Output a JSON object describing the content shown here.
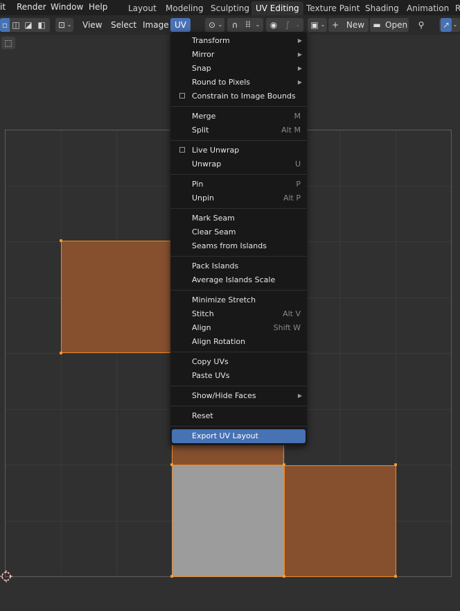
{
  "topbar": {
    "menus": [
      "it",
      "Render",
      "Window",
      "Help"
    ],
    "workspaces": [
      "Layout",
      "Modeling",
      "Sculpting",
      "UV Editing",
      "Texture Paint",
      "Shading",
      "Animation",
      "R"
    ],
    "active_workspace": "UV Editing"
  },
  "header": {
    "view": "View",
    "select": "Select",
    "image": "Image",
    "uv": "UV",
    "new": "New",
    "open": "Open"
  },
  "uv_menu": {
    "items": [
      {
        "label": "Transform",
        "submenu": true
      },
      {
        "label": "Mirror",
        "submenu": true
      },
      {
        "label": "Snap",
        "submenu": true
      },
      {
        "label": "Round to Pixels",
        "submenu": true
      },
      {
        "label": "Constrain to Image Bounds",
        "checkbox": true
      },
      {
        "label": "Merge",
        "shortcut": "M"
      },
      {
        "label": "Split",
        "shortcut": "Alt M"
      },
      {
        "label": "Live Unwrap",
        "checkbox": true
      },
      {
        "label": "Unwrap",
        "shortcut": "U"
      },
      {
        "label": "Pin",
        "shortcut": "P"
      },
      {
        "label": "Unpin",
        "shortcut": "Alt P"
      },
      {
        "label": "Mark Seam"
      },
      {
        "label": "Clear Seam"
      },
      {
        "label": "Seams from Islands"
      },
      {
        "label": "Pack Islands"
      },
      {
        "label": "Average Islands Scale"
      },
      {
        "label": "Minimize Stretch"
      },
      {
        "label": "Stitch",
        "shortcut": "Alt V"
      },
      {
        "label": "Align",
        "shortcut": "Shift W"
      },
      {
        "label": "Align Rotation"
      },
      {
        "label": "Copy UVs"
      },
      {
        "label": "Paste UVs"
      },
      {
        "label": "Show/Hide Faces",
        "submenu": true
      },
      {
        "label": "Reset"
      },
      {
        "label": "Export UV Layout",
        "highlighted": true
      }
    ]
  },
  "colors": {
    "accent": "#4772b3",
    "face": "#86502f",
    "face_selected_edge": "#f08a24",
    "face_grey": "#9c9c9c"
  }
}
